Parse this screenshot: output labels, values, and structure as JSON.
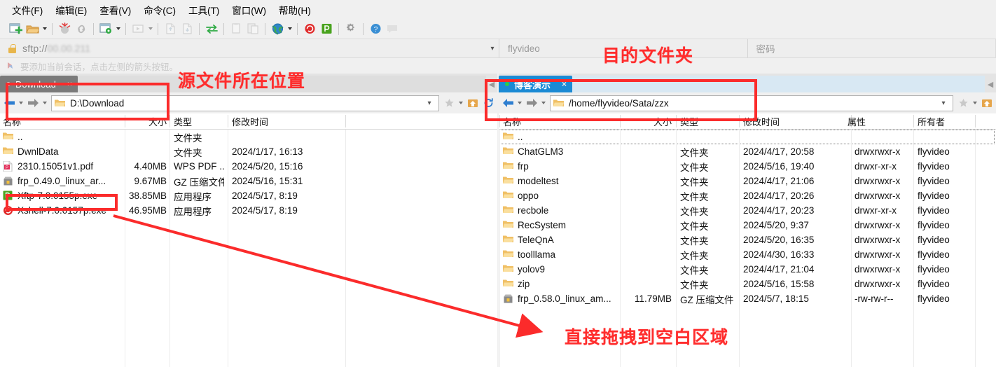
{
  "menubar": {
    "items": [
      {
        "label": "文件(F)",
        "name": "menu-file"
      },
      {
        "label": "编辑(E)",
        "name": "menu-edit"
      },
      {
        "label": "查看(V)",
        "name": "menu-view"
      },
      {
        "label": "命令(C)",
        "name": "menu-command"
      },
      {
        "label": "工具(T)",
        "name": "menu-tools"
      },
      {
        "label": "窗口(W)",
        "name": "menu-window"
      },
      {
        "label": "帮助(H)",
        "name": "menu-help"
      }
    ]
  },
  "toolbar": {
    "buttons": [
      {
        "name": "new-session-icon",
        "title": "新建会话"
      },
      {
        "name": "open-folder-icon",
        "title": "打开"
      },
      {
        "name": "disconnect-icon",
        "title": "断开"
      },
      {
        "name": "link-icon",
        "title": "链接"
      },
      {
        "name": "session-manager-icon",
        "title": "会话管理"
      },
      {
        "name": "transfer-queue-icon",
        "title": "传输队列"
      },
      {
        "name": "upload-icon",
        "title": "上传"
      },
      {
        "name": "download-icon",
        "title": "下载"
      },
      {
        "name": "sync-icon",
        "title": "同步浏览"
      },
      {
        "name": "copy-icon",
        "title": "复制"
      },
      {
        "name": "paste-icon",
        "title": "粘贴"
      },
      {
        "name": "globe-icon",
        "title": "浏览器"
      },
      {
        "name": "xshell-icon",
        "title": "Xshell"
      },
      {
        "name": "xftp-icon",
        "title": "Xftp"
      },
      {
        "name": "gear-icon",
        "title": "属性"
      },
      {
        "name": "help-icon",
        "title": "帮助"
      },
      {
        "name": "feedback-icon",
        "title": "反馈"
      }
    ]
  },
  "session_bar": {
    "url_prefix": "sftp://",
    "url_masked": "00.00.211",
    "username_placeholder": "flyvideo",
    "password_placeholder": "密码"
  },
  "notice": {
    "text": "要添加当前会话，点击左侧的箭头按钮。"
  },
  "left_pane": {
    "tab": {
      "label": "Download",
      "close": "×"
    },
    "path": "D:\\Download",
    "columns": [
      {
        "label": "名称",
        "name": "col-name"
      },
      {
        "label": "大小",
        "name": "col-size"
      },
      {
        "label": "类型",
        "name": "col-type"
      },
      {
        "label": "修改时间",
        "name": "col-modified"
      }
    ],
    "rows": [
      {
        "icon": "folder-icon",
        "name": "..",
        "size": "",
        "type": "文件夹",
        "modified": ""
      },
      {
        "icon": "folder-icon",
        "name": "DwnlData",
        "size": "",
        "type": "文件夹",
        "modified": "2024/1/17, 16:13"
      },
      {
        "icon": "pdf-icon",
        "name": "2310.15051v1.pdf",
        "size": "4.40MB",
        "type": "WPS PDF ...",
        "modified": "2024/5/20, 15:16"
      },
      {
        "icon": "archive-icon",
        "name": "frp_0.49.0_linux_ar...",
        "size": "9.67MB",
        "type": "GZ 压缩文件",
        "modified": "2024/5/16, 15:31"
      },
      {
        "icon": "xftp-icon",
        "name": "Xftp-7.0.0155p.exe",
        "size": "38.85MB",
        "type": "应用程序",
        "modified": "2024/5/17, 8:19"
      },
      {
        "icon": "xshell-icon",
        "name": "Xshell-7.0.0157p.exe",
        "size": "46.95MB",
        "type": "应用程序",
        "modified": "2024/5/17, 8:19"
      }
    ]
  },
  "right_pane": {
    "tab": {
      "label": "博客演示",
      "close": "×"
    },
    "path": "/home/flyvideo/Sata/zzx",
    "columns": [
      {
        "label": "名称",
        "name": "col-name"
      },
      {
        "label": "大小",
        "name": "col-size"
      },
      {
        "label": "类型",
        "name": "col-type"
      },
      {
        "label": "修改时间",
        "name": "col-modified"
      },
      {
        "label": "属性",
        "name": "col-attributes"
      },
      {
        "label": "所有者",
        "name": "col-owner"
      }
    ],
    "rows": [
      {
        "icon": "folder-icon",
        "name": "..",
        "size": "",
        "type": "",
        "modified": "",
        "attributes": "",
        "owner": ""
      },
      {
        "icon": "folder-icon",
        "name": "ChatGLM3",
        "size": "",
        "type": "文件夹",
        "modified": "2024/4/17, 20:58",
        "attributes": "drwxrwxr-x",
        "owner": "flyvideo"
      },
      {
        "icon": "folder-icon",
        "name": "frp",
        "size": "",
        "type": "文件夹",
        "modified": "2024/5/16, 19:40",
        "attributes": "drwxr-xr-x",
        "owner": "flyvideo"
      },
      {
        "icon": "folder-icon",
        "name": "modeltest",
        "size": "",
        "type": "文件夹",
        "modified": "2024/4/17, 21:06",
        "attributes": "drwxrwxr-x",
        "owner": "flyvideo"
      },
      {
        "icon": "folder-icon",
        "name": "oppo",
        "size": "",
        "type": "文件夹",
        "modified": "2024/4/17, 20:26",
        "attributes": "drwxrwxr-x",
        "owner": "flyvideo"
      },
      {
        "icon": "folder-icon",
        "name": "recbole",
        "size": "",
        "type": "文件夹",
        "modified": "2024/4/17, 20:23",
        "attributes": "drwxr-xr-x",
        "owner": "flyvideo"
      },
      {
        "icon": "folder-icon",
        "name": "RecSystem",
        "size": "",
        "type": "文件夹",
        "modified": "2024/5/20, 9:37",
        "attributes": "drwxrwxr-x",
        "owner": "flyvideo"
      },
      {
        "icon": "folder-icon",
        "name": "TeleQnA",
        "size": "",
        "type": "文件夹",
        "modified": "2024/5/20, 16:35",
        "attributes": "drwxrwxr-x",
        "owner": "flyvideo"
      },
      {
        "icon": "folder-icon",
        "name": "toolllama",
        "size": "",
        "type": "文件夹",
        "modified": "2024/4/30, 16:33",
        "attributes": "drwxrwxr-x",
        "owner": "flyvideo"
      },
      {
        "icon": "folder-icon",
        "name": "yolov9",
        "size": "",
        "type": "文件夹",
        "modified": "2024/4/17, 21:04",
        "attributes": "drwxrwxr-x",
        "owner": "flyvideo"
      },
      {
        "icon": "folder-icon",
        "name": "zip",
        "size": "",
        "type": "文件夹",
        "modified": "2024/5/16, 15:58",
        "attributes": "drwxrwxr-x",
        "owner": "flyvideo"
      },
      {
        "icon": "archive-icon",
        "name": "frp_0.58.0_linux_am...",
        "size": "11.79MB",
        "type": "GZ 压缩文件",
        "modified": "2024/5/7, 18:15",
        "attributes": "-rw-rw-r--",
        "owner": "flyvideo"
      }
    ]
  },
  "annotations": {
    "source_label": "源文件所在位置",
    "destination_label": "目的文件夹",
    "drop_label": "直接拖拽到空白区域",
    "color": "#ff2d2d"
  }
}
